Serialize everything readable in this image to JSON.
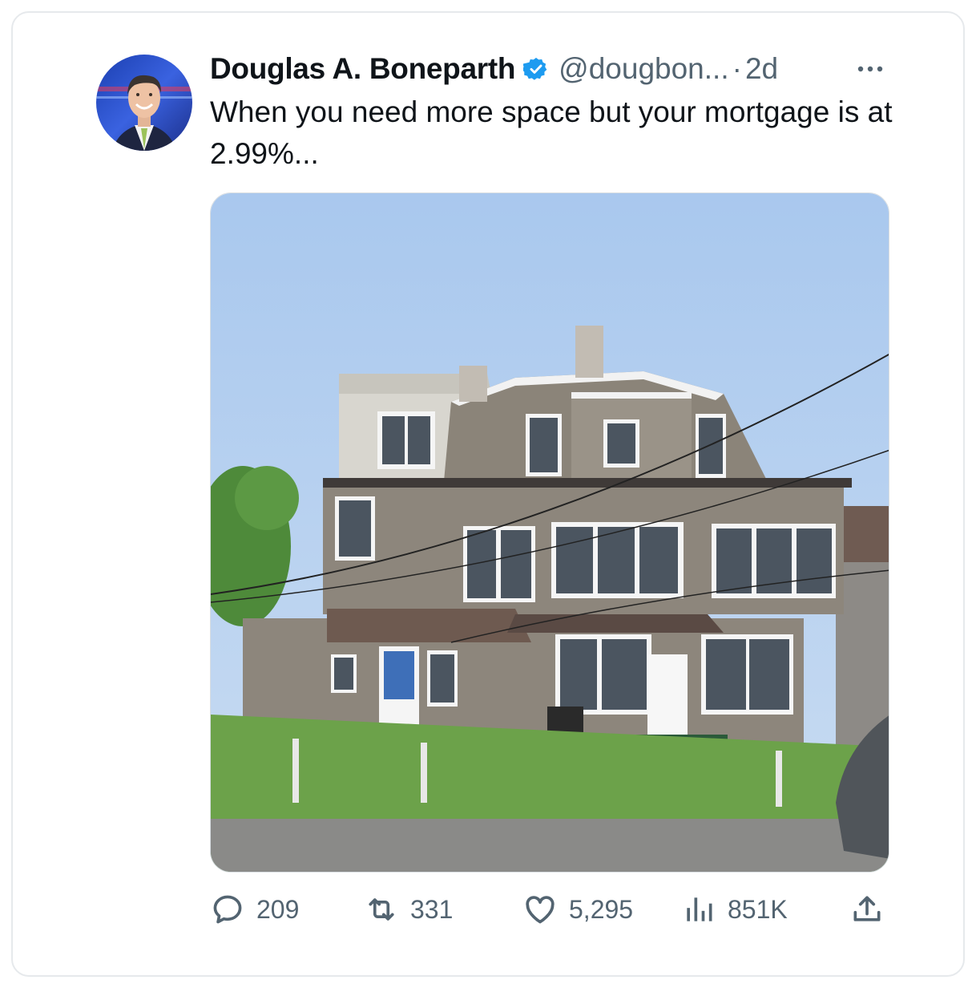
{
  "tweet": {
    "author_name": "Douglas A. Boneparth",
    "handle": "@dougbon...",
    "separator": "·",
    "time": "2d",
    "text": "When you need more space but your mortgage is at 2.99%...",
    "verified_color": "#1d9bf0"
  },
  "actions": {
    "replies": "209",
    "reposts": "331",
    "likes": "5,295",
    "views": "851K"
  },
  "icons": [
    "verified-badge-icon",
    "more-icon",
    "reply-icon",
    "repost-icon",
    "like-icon",
    "views-icon",
    "share-icon"
  ]
}
